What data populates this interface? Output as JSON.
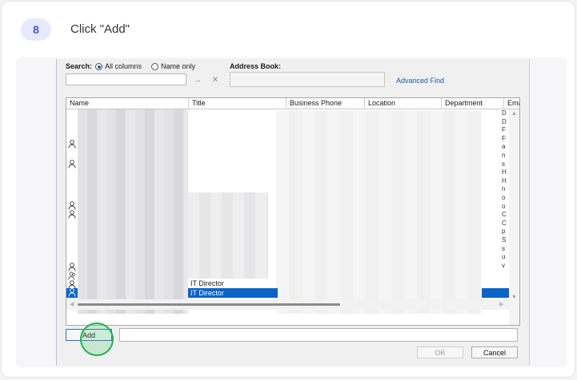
{
  "step": {
    "number": "8",
    "instruction": "Click \"Add\""
  },
  "search": {
    "label": "Search:",
    "option_all": "All columns",
    "option_name": "Name only",
    "address_book_label": "Address Book:",
    "advanced_find": "Advanced Find"
  },
  "columns": [
    "Name",
    "Title",
    "Business Phone",
    "Location",
    "Department",
    "Ema"
  ],
  "rows": [
    {
      "title": "IT Director"
    },
    {
      "title": "IT Director"
    }
  ],
  "email_letters": [
    "D",
    "D",
    "F",
    "F",
    "a",
    "n",
    "s",
    "H",
    "H",
    "n",
    "o",
    "o",
    "C",
    "C",
    "p",
    "S",
    "s",
    "u",
    "v",
    "v"
  ],
  "buttons": {
    "add": "Add",
    "ok": "OK",
    "cancel": "Cancel"
  },
  "colors": {
    "accent": "#4b55d6",
    "selection": "#0a64c8",
    "highlight": "#22b34e"
  }
}
